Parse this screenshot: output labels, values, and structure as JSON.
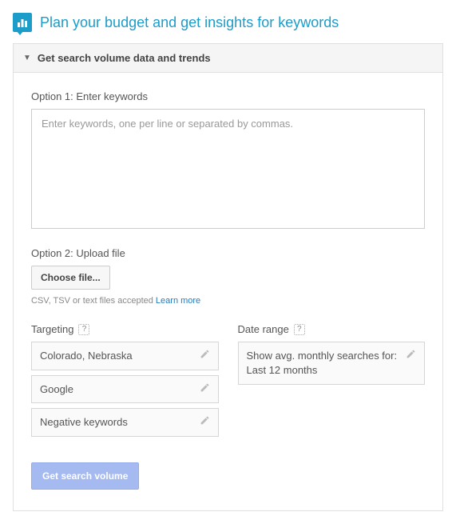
{
  "header": {
    "title": "Plan your budget and get insights for keywords"
  },
  "panel": {
    "title": "Get search volume data and trends"
  },
  "option1": {
    "label": "Option 1: Enter keywords",
    "placeholder": "Enter keywords, one per line or separated by commas."
  },
  "option2": {
    "label": "Option 2: Upload file",
    "button": "Choose file...",
    "helper_text": "CSV, TSV or text files accepted ",
    "learn_more": "Learn more"
  },
  "targeting": {
    "label": "Targeting",
    "help": "?",
    "fields": [
      "Colorado, Nebraska",
      "Google",
      "Negative keywords"
    ]
  },
  "daterange": {
    "label": "Date range",
    "help": "?",
    "value": "Show avg. monthly searches for: Last 12 months"
  },
  "submit": {
    "label": "Get search volume"
  }
}
